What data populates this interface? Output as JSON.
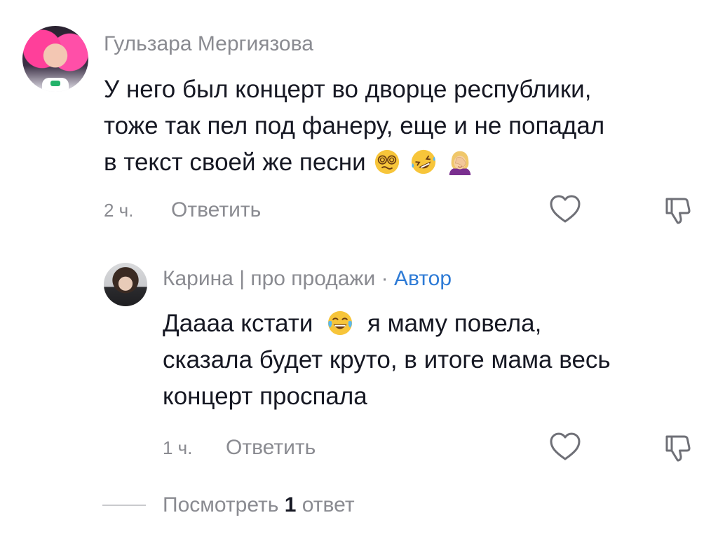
{
  "comments": [
    {
      "username": "Гульзара Мергиязова",
      "text_lines": [
        "У него был концерт во дворце республики,",
        "тоже так пел под фанеру, еще и не попадал",
        "в текст своей же песни"
      ],
      "emojis": [
        "dizzy-face-emoji",
        "rolling-laughing-emoji",
        "facepalm-woman-emoji"
      ],
      "time": "2 ч.",
      "reply_label": "Ответить",
      "icons": [
        "heart-icon",
        "thumbs-down-icon"
      ]
    },
    {
      "username": "Карина | про продажи",
      "separator": "·",
      "badge": "Автор",
      "text_lines": [
        "Даааа кстати",
        "я маму повела,",
        "сказала будет круто, в итоге мама весь",
        "концерт проспала"
      ],
      "emojis": [
        "tears-of-joy-emoji"
      ],
      "time": "1 ч.",
      "reply_label": "Ответить",
      "icons": [
        "heart-icon",
        "thumbs-down-icon"
      ]
    }
  ],
  "view_replies": {
    "prefix": "Посмотреть",
    "count": "1",
    "suffix": "ответ"
  },
  "colors": {
    "text": "#161823",
    "muted": "#8a8b91",
    "author_badge": "#2e7bd6",
    "divider": "#c9cacd"
  }
}
